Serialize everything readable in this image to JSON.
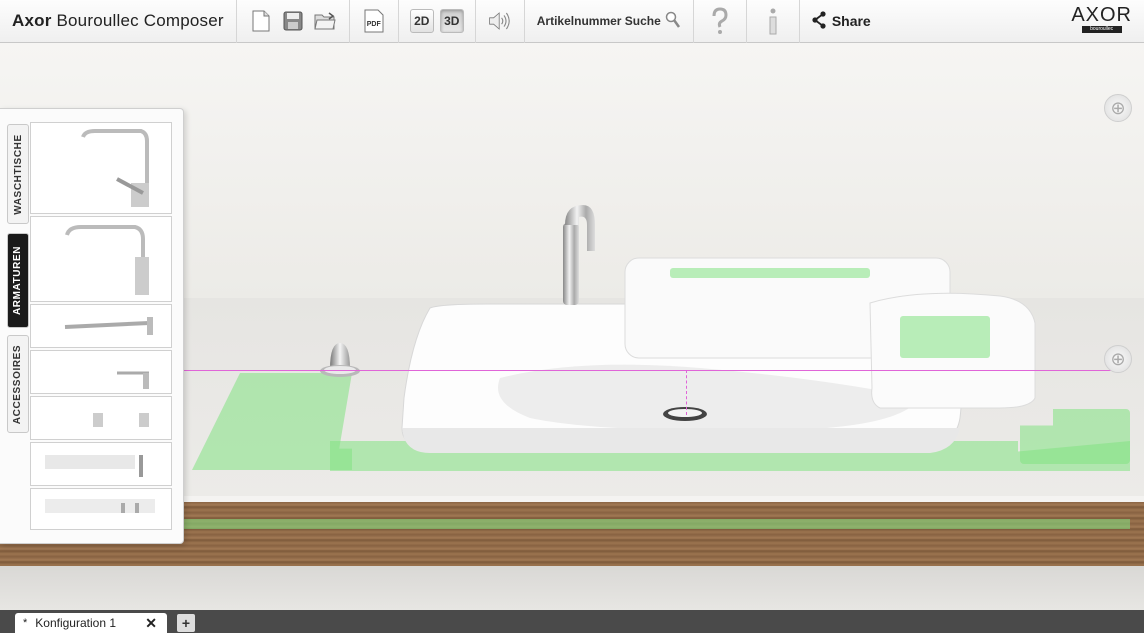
{
  "app": {
    "title_bold": "Axor",
    "title_rest": "Bouroullec Composer",
    "brand": "AXOR",
    "brand_sub": "bouroullec"
  },
  "toolbar": {
    "new_icon": "new-document-icon",
    "save_icon": "save-icon",
    "open_icon": "open-folder-icon",
    "pdf_label": "PDF",
    "view_2d": "2D",
    "view_3d": "3D",
    "active_view": "3D",
    "sound_icon": "speaker-icon",
    "search_label": "Artikelnummer Suche",
    "help_icon": "question-mark-icon",
    "info_icon": "info-icon",
    "share_label": "Share"
  },
  "panel": {
    "tabs": [
      {
        "label": "WASCHTISCHE",
        "active": false
      },
      {
        "label": "ARMATUREN",
        "active": true
      },
      {
        "label": "ACCESSOIRES",
        "active": false
      }
    ],
    "thumbnails": [
      {
        "name": "faucet-tall-lever"
      },
      {
        "name": "faucet-tall-spout"
      },
      {
        "name": "wall-spout"
      },
      {
        "name": "small-lever-faucet"
      },
      {
        "name": "two-handles"
      },
      {
        "name": "wall-mixer"
      },
      {
        "name": "double-valve"
      }
    ]
  },
  "scene": {
    "accent_color": "#e065d8",
    "zone_color": "#82e182"
  },
  "tabs": {
    "modified_marker": "*",
    "document_tab": "Konfiguration 1",
    "close_label": "✕",
    "add_label": "+"
  }
}
